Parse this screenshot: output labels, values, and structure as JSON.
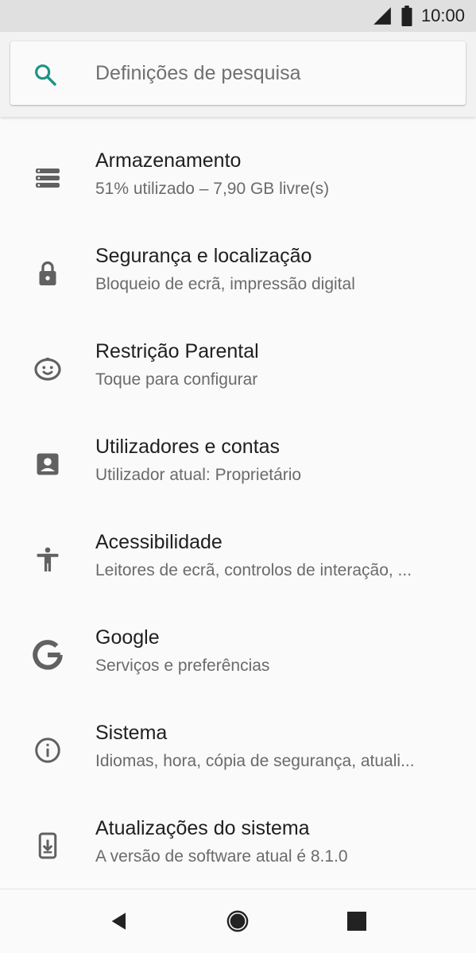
{
  "status_bar": {
    "time": "10:00",
    "icons": [
      "signal-icon",
      "battery-icon"
    ]
  },
  "search": {
    "placeholder": "Definições de pesquisa",
    "icon": "search-icon",
    "accent": "#1e9384"
  },
  "items": [
    {
      "name": "storage",
      "icon": "storage-icon",
      "title": "Armazenamento",
      "subtitle": "51% utilizado – 7,90 GB livre(s)"
    },
    {
      "name": "security-location",
      "icon": "lock-icon",
      "title": "Segurança e localização",
      "subtitle": "Bloqueio de ecrã, impressão digital"
    },
    {
      "name": "parental-restriction",
      "icon": "child-face-icon",
      "title": "Restrição Parental",
      "subtitle": "Toque para configurar"
    },
    {
      "name": "users-accounts",
      "icon": "account-box-icon",
      "title": "Utilizadores e contas",
      "subtitle": "Utilizador atual: Proprietário"
    },
    {
      "name": "accessibility",
      "icon": "accessibility-icon",
      "title": "Acessibilidade",
      "subtitle": "Leitores de ecrã, controlos de interação, ..."
    },
    {
      "name": "google",
      "icon": "google-icon",
      "title": "Google",
      "subtitle": "Serviços e preferências"
    },
    {
      "name": "system",
      "icon": "info-icon",
      "title": "Sistema",
      "subtitle": "Idiomas, hora, cópia de segurança, atuali..."
    },
    {
      "name": "system-updates",
      "icon": "system-update-icon",
      "title": "Atualizações do sistema",
      "subtitle": "A versão de software atual é 8.1.0"
    }
  ],
  "nav": [
    "back-icon",
    "home-icon",
    "recents-icon"
  ],
  "colors": {
    "icon": "#616161",
    "title": "#202020",
    "subtitle": "#6b6b6b",
    "background": "#fafafa"
  }
}
